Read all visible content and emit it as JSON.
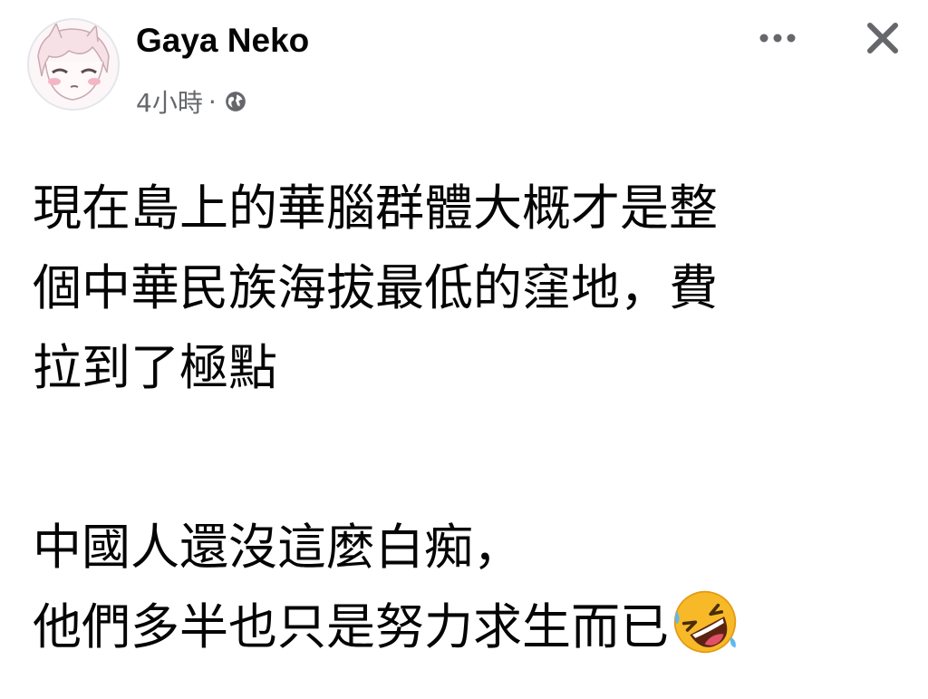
{
  "post": {
    "author": {
      "name": "Gaya Neko",
      "avatar_icon": "anime-avatar-icon"
    },
    "timestamp": "4小時",
    "separator": "·",
    "audience_icon": "globe-icon",
    "actions": {
      "more_icon": "more-horizontal-icon",
      "close_icon": "close-icon"
    },
    "body": {
      "lines": [
        "現在島上的華腦群體大概才是整",
        "個中華民族海拔最低的窪地，費",
        "拉到了極點",
        "中國人還沒這麼白痴，",
        "他們多半也只是努力求生而已"
      ],
      "trailing_emoji": "rolling-on-floor-laughing-emoji"
    }
  },
  "colors": {
    "text_primary": "#050505",
    "text_secondary": "#65676b",
    "background": "#ffffff",
    "emoji_yellow": "#f7b928"
  }
}
